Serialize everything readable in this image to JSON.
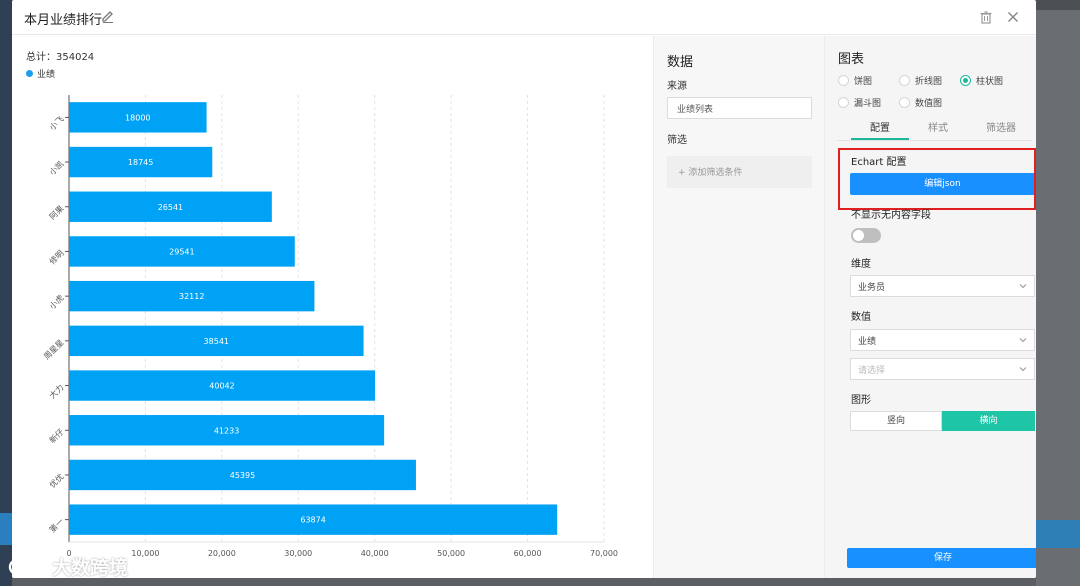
{
  "modal": {
    "title": "本月业绩排行"
  },
  "chart_header": {
    "total": "总计：354024",
    "legend": "业绩"
  },
  "chart_data": {
    "type": "bar",
    "orientation": "horizontal",
    "categories": [
      "小飞",
      "小凯",
      "阿果",
      "修明",
      "小虎",
      "周星星",
      "大力",
      "新仔",
      "优优",
      "第一"
    ],
    "series": [
      {
        "name": "业绩",
        "values": [
          18000,
          18745,
          26541,
          29541,
          32112,
          38541,
          40042,
          41233,
          45395,
          63874
        ]
      }
    ],
    "xlim": [
      0,
      70000
    ],
    "xticks": [
      0,
      10000,
      20000,
      30000,
      40000,
      50000,
      60000,
      70000
    ],
    "xtick_labels": [
      "0",
      "10,000",
      "20,000",
      "30,000",
      "40,000",
      "50,000",
      "60,000",
      "70,000"
    ],
    "grid": true,
    "bar_color": "#00a2f5",
    "legend_position": "top-left",
    "data_labels": true
  },
  "data_panel": {
    "title": "数据",
    "source_label": "来源",
    "source_value": "业绩列表",
    "filter_label": "筛选",
    "add_filter": "+ 添加筛选条件"
  },
  "chart_panel": {
    "title": "图表",
    "chart_types": [
      {
        "label": "饼图",
        "checked": false
      },
      {
        "label": "折线图",
        "checked": false
      },
      {
        "label": "柱状图",
        "checked": true
      },
      {
        "label": "漏斗图",
        "checked": false
      },
      {
        "label": "数值图",
        "checked": false
      }
    ],
    "tabs": [
      "配置",
      "样式",
      "筛选器"
    ],
    "active_tab": "配置",
    "echart_label": "Echart 配置",
    "edit_json": "编辑json",
    "hide_empty_label": "不显示无内容字段",
    "dimension_label": "维度",
    "dimension_value": "业务员",
    "value_label": "数值",
    "value_value": "业绩",
    "value_placeholder": "请选择",
    "shape_label": "图形",
    "shape_vertical": "竖向",
    "shape_horizontal": "横向",
    "save": "保存"
  },
  "watermark": {
    "text": "大数跨境"
  },
  "colors": {
    "accent": "#1890ff",
    "teal": "#1fc5a7",
    "bar": "#00a2f5",
    "highlight": "#e02020"
  }
}
